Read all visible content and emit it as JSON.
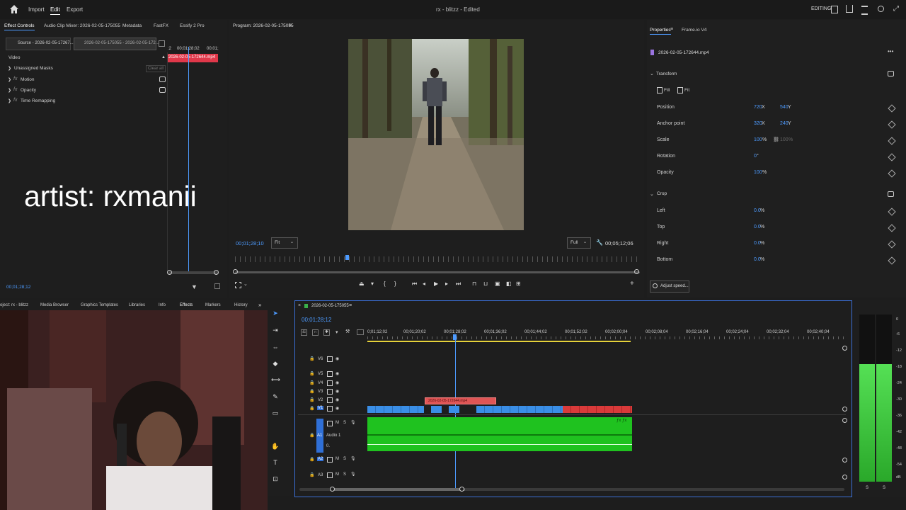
{
  "app": {
    "menu": [
      "Import",
      "Edit",
      "Export"
    ],
    "active_menu": "Edit",
    "title": "rx - blitzz - Edited",
    "workspace": "EDITING"
  },
  "effect_controls": {
    "tabs": [
      "Effect Controls",
      "Audio Clip Mixer: 2026-02-05-175055",
      "Metadata",
      "FastFX",
      "Essify 2 Pro"
    ],
    "source_tab": "Source - 2026-02-05-17267...",
    "sequence_tab": "2026-02-05-175055 - 2026-02-05-172...",
    "ruler": [
      ":2",
      "00;01;28;02",
      "00;01;"
    ],
    "clip_name": "2026-02-05-172644.mp4",
    "video_label": "Video",
    "masks_label": "Unassigned Masks",
    "clear_all": "Clear all",
    "effects": [
      {
        "name": "Motion",
        "fx": "fx"
      },
      {
        "name": "Opacity",
        "fx": "fx"
      },
      {
        "name": "Time Remapping",
        "fx": "fx"
      }
    ],
    "timecode": "00;01;28;12"
  },
  "overlay_text": "artist: rxmanii",
  "program": {
    "title": "Program: 2026-02-05-175055",
    "timecode": "00;01;28;10",
    "fit": "Fit",
    "quality": "Full",
    "duration": "00;05;12;06"
  },
  "properties": {
    "tabs": [
      "Properties",
      "Frame.io V4"
    ],
    "clip": "2026-02-05-172644.mp4",
    "transform_label": "Transform",
    "fill_label": "Fill",
    "fit_label": "Fit",
    "rows": [
      {
        "label": "Position",
        "v1": "720",
        "u1": "X",
        "v2": "540",
        "u2": "Y"
      },
      {
        "label": "Anchor point",
        "v1": "320",
        "u1": "X",
        "v2": "240",
        "u2": "Y"
      },
      {
        "label": "Scale",
        "v1": "100",
        "u1": "%",
        "v2": "100",
        "u2": "%"
      },
      {
        "label": "Rotation",
        "v1": "0",
        "u1": "°",
        "v2": "",
        "u2": ""
      },
      {
        "label": "Opacity",
        "v1": "100",
        "u1": "%",
        "v2": "",
        "u2": ""
      }
    ],
    "crop_label": "Crop",
    "crop_rows": [
      {
        "label": "Left",
        "v1": "0.0",
        "u1": "%"
      },
      {
        "label": "Top",
        "v1": "0.0",
        "u1": "%"
      },
      {
        "label": "Right",
        "v1": "0.0",
        "u1": "%"
      },
      {
        "label": "Bottom",
        "v1": "0.0",
        "u1": "%"
      }
    ],
    "adjust_speed": "Adjust speed..."
  },
  "project_tabs": [
    "oject: rx - blitzz",
    "Media Browser",
    "Graphics Templates",
    "Libraries",
    "Info",
    "Effects",
    "Markers",
    "History"
  ],
  "timeline": {
    "sequence": "2026-02-05-175055",
    "timecode": "00;01;28;12",
    "ruler": [
      "0;01;12;02",
      "00;01;20;02",
      "00;01;28;02",
      "00;01;36;02",
      "00;01;44;02",
      "00;01;52;02",
      "00;02;00;04",
      "00;02;08;04",
      "00;02;16;04",
      "00;02;24;04",
      "00;02;32;04",
      "00;02;40;04"
    ],
    "video_tracks": [
      "V6",
      "V5",
      "V4",
      "V3",
      "V2",
      "V1"
    ],
    "audio_tracks": [
      "A1",
      "A2",
      "A3"
    ],
    "audio_name": "Audio 1",
    "v2_clip": "2026-02-05-172644.mp4",
    "vol": "0."
  },
  "meter": [
    "0",
    "-6",
    "-12",
    "-18",
    "-24",
    "-30",
    "-36",
    "-42",
    "-48",
    "-54",
    "dB"
  ],
  "meter_bottom": [
    "S",
    "S"
  ],
  "colors": {
    "accent": "#4d9bff",
    "clip_blue": "#3a8ee6",
    "clip_red": "#d93a3a",
    "audio_green": "#1fc21f",
    "v2_clip": "#e05555"
  }
}
